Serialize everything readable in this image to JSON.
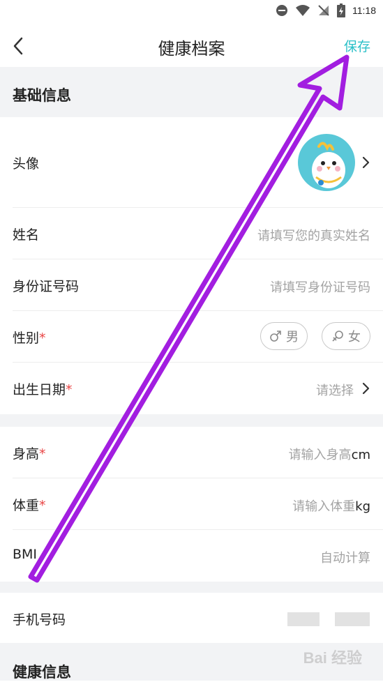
{
  "status_bar": {
    "time": "11:18"
  },
  "header": {
    "title": "健康档案",
    "save_label": "保存"
  },
  "basic_section": {
    "title": "基础信息"
  },
  "avatar_row": {
    "label": "头像"
  },
  "name_row": {
    "label": "姓名",
    "placeholder": "请填写您的真实姓名"
  },
  "id_row": {
    "label": "身份证号码",
    "placeholder": "请填写身份证号码"
  },
  "gender_row": {
    "label": "性别",
    "required_mark": "*",
    "male": "男",
    "female": "女"
  },
  "birth_row": {
    "label": "出生日期",
    "required_mark": "*",
    "value": "请选择"
  },
  "height_row": {
    "label": "身高",
    "required_mark": "*",
    "placeholder": "请输入身高",
    "unit": "cm"
  },
  "weight_row": {
    "label": "体重",
    "required_mark": "*",
    "placeholder": "请输入体重",
    "unit": "kg"
  },
  "bmi_row": {
    "label": "BMI",
    "value": "自动计算"
  },
  "phone_row": {
    "label": "手机号码"
  },
  "health_section": {
    "title": "健康信息"
  },
  "watermark": {
    "text": "Bai 经验"
  },
  "colors": {
    "accent": "#2bc0c8",
    "required": "#e94545",
    "annotation_arrow": "#a21ee0"
  }
}
